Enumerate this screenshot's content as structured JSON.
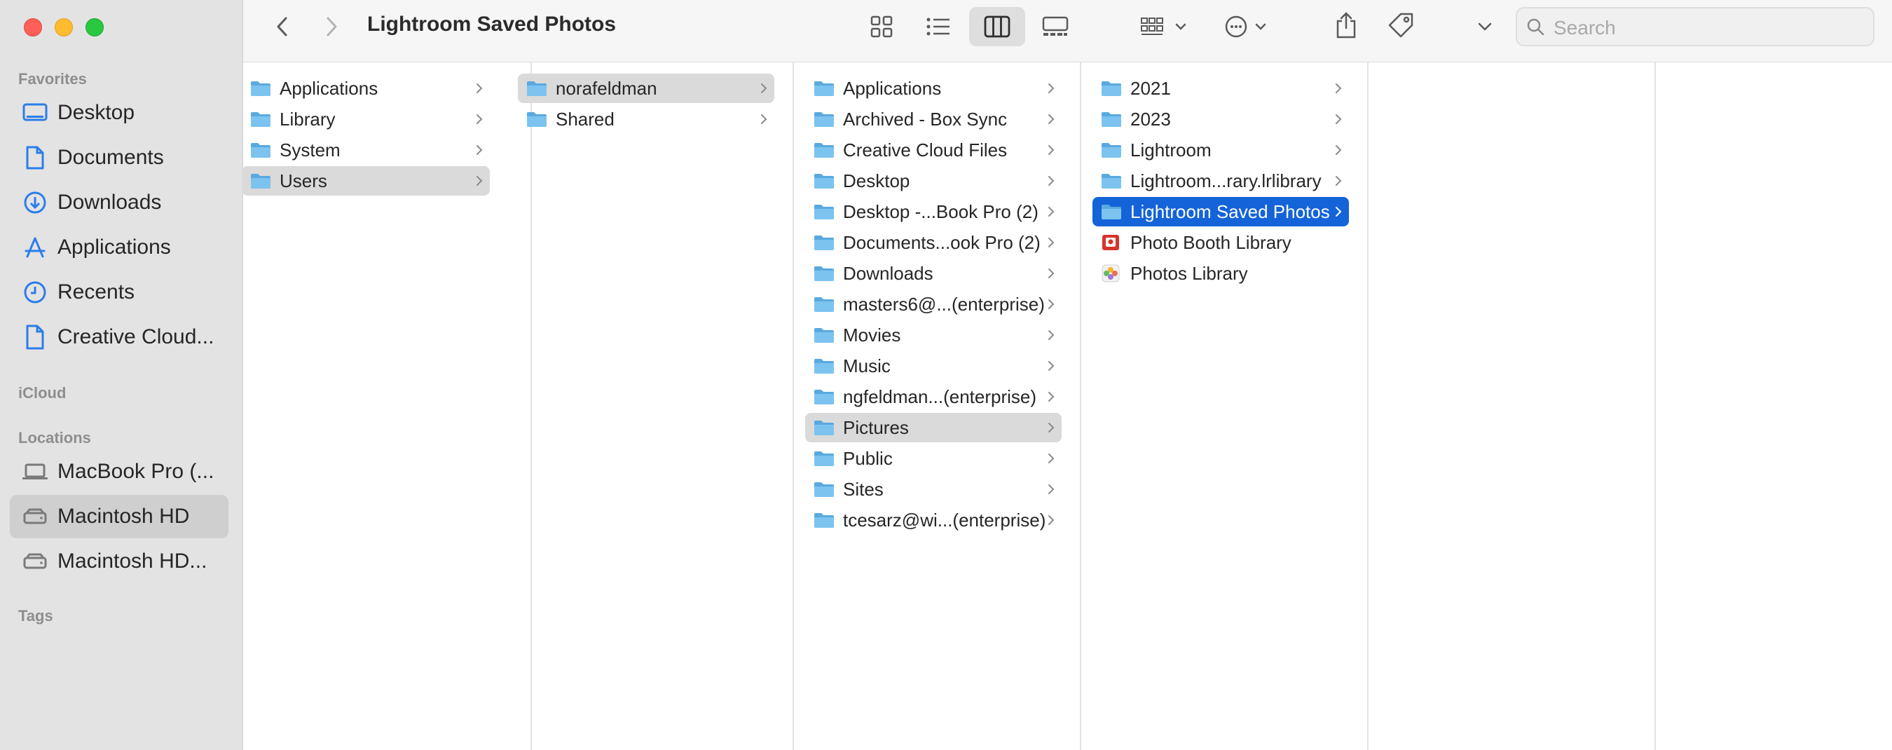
{
  "window": {
    "title": "Lightroom Saved Photos"
  },
  "sidebar": {
    "sections": [
      {
        "label": "Favorites"
      },
      {
        "label": "iCloud"
      },
      {
        "label": "Locations"
      },
      {
        "label": "Tags"
      }
    ],
    "favorites": [
      {
        "label": "Desktop",
        "icon": "desktop-icon"
      },
      {
        "label": "Documents",
        "icon": "document-icon"
      },
      {
        "label": "Downloads",
        "icon": "download-icon"
      },
      {
        "label": "Applications",
        "icon": "applications-icon"
      },
      {
        "label": "Recents",
        "icon": "clock-icon"
      },
      {
        "label": "Creative Cloud...",
        "icon": "file-icon"
      }
    ],
    "locations": [
      {
        "label": "MacBook Pro (...",
        "icon": "laptop-icon"
      },
      {
        "label": "Macintosh HD",
        "icon": "disk-icon",
        "selected": true
      },
      {
        "label": "Macintosh HD...",
        "icon": "disk-icon"
      }
    ]
  },
  "toolbar": {
    "back": "back-icon",
    "forward": "forward-icon",
    "search_placeholder": "Search"
  },
  "columns": [
    {
      "items": [
        {
          "label": "Applications",
          "chevron": true
        },
        {
          "label": "Library",
          "chevron": true
        },
        {
          "label": "System",
          "chevron": true
        },
        {
          "label": "Users",
          "chevron": true,
          "state": "gray"
        }
      ]
    },
    {
      "items": [
        {
          "label": "norafeldman",
          "chevron": true,
          "state": "gray"
        },
        {
          "label": "Shared",
          "chevron": true
        }
      ]
    },
    {
      "items": [
        {
          "label": "Applications",
          "chevron": true
        },
        {
          "label": "Archived - Box Sync",
          "chevron": true
        },
        {
          "label": "Creative Cloud Files",
          "chevron": true
        },
        {
          "label": "Desktop",
          "chevron": true
        },
        {
          "label": "Desktop -...Book Pro (2)",
          "chevron": true
        },
        {
          "label": "Documents...ook Pro (2)",
          "chevron": true
        },
        {
          "label": "Downloads",
          "chevron": true
        },
        {
          "label": "masters6@...(enterprise)",
          "chevron": true
        },
        {
          "label": "Movies",
          "chevron": true
        },
        {
          "label": "Music",
          "chevron": true
        },
        {
          "label": "ngfeldman...(enterprise)",
          "chevron": true
        },
        {
          "label": "Pictures",
          "chevron": true,
          "state": "gray"
        },
        {
          "label": "Public",
          "chevron": true
        },
        {
          "label": "Sites",
          "chevron": true
        },
        {
          "label": "tcesarz@wi...(enterprise)",
          "chevron": true
        }
      ]
    },
    {
      "items": [
        {
          "label": "2021",
          "chevron": true
        },
        {
          "label": "2023",
          "chevron": true
        },
        {
          "label": "Lightroom",
          "chevron": true
        },
        {
          "label": "Lightroom...rary.lrlibrary",
          "chevron": true
        },
        {
          "label": "Lightroom Saved Photos",
          "chevron": true,
          "state": "blue"
        },
        {
          "label": "Photo Booth Library",
          "chevron": false,
          "icon": "photo-booth-icon"
        },
        {
          "label": "Photos Library",
          "chevron": false,
          "icon": "photos-icon"
        }
      ]
    },
    {
      "items": []
    },
    {
      "items": []
    }
  ],
  "colors": {
    "selection_blue": "#1463d9",
    "folder_blue": "#5fb3e6",
    "sidebar_bg": "#e4e3e3"
  }
}
